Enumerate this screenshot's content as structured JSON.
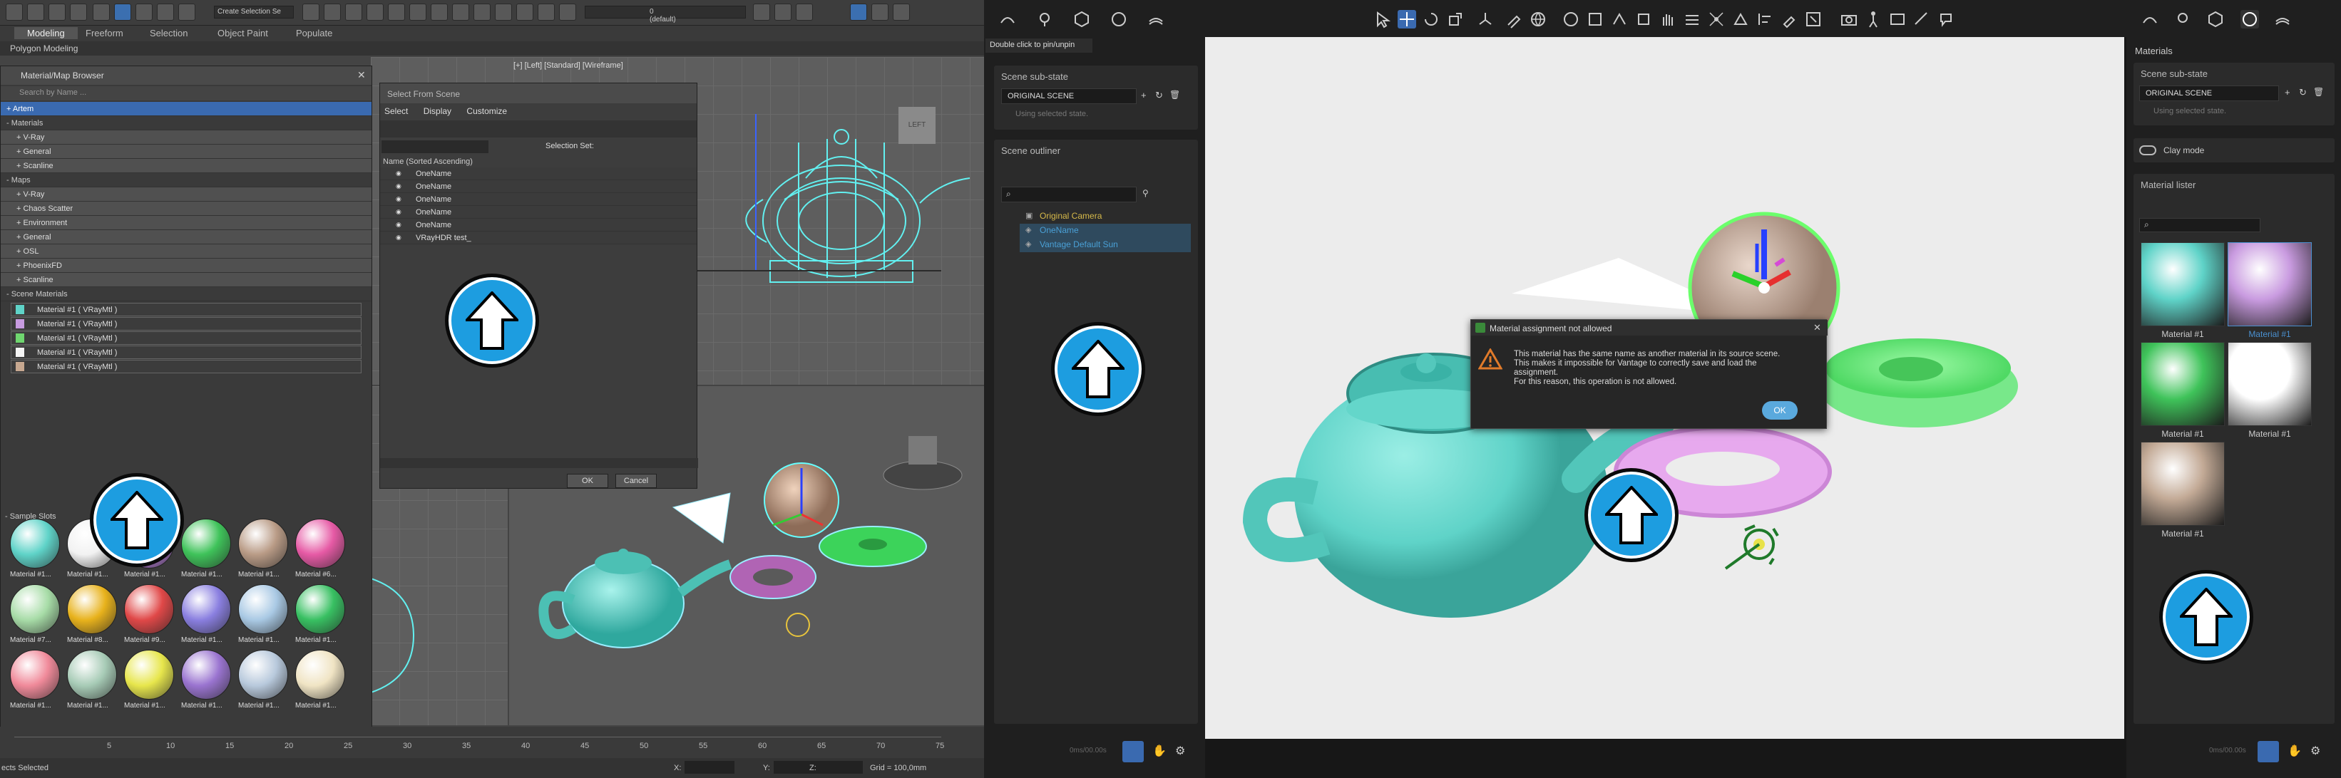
{
  "max": {
    "toolbar": {
      "create_selection_set": "Create Selection Se",
      "layer_value": "0 (default)"
    },
    "ribbon_tabs": [
      "Modeling",
      "Freeform",
      "Selection",
      "Object Paint",
      "Populate"
    ],
    "polygon_modeling": "Polygon Modeling",
    "viewport_label": "[+] [Left] [Standard] [Wireframe]",
    "viewcube_label": "LEFT",
    "material_browser": {
      "title": "Material/Map Browser",
      "search_placeholder": "Search by Name ...",
      "items": [
        {
          "label": "+ Artem",
          "kind": "hi"
        },
        {
          "label": "- Materials",
          "kind": "hdr"
        },
        {
          "label": "+ V-Ray",
          "kind": "sub"
        },
        {
          "label": "+ General",
          "kind": "sub"
        },
        {
          "label": "+ Scanline",
          "kind": "sub"
        },
        {
          "label": "- Maps",
          "kind": "hdr"
        },
        {
          "label": "+ V-Ray",
          "kind": "sub"
        },
        {
          "label": "+ Chaos Scatter",
          "kind": "sub"
        },
        {
          "label": "+ Environment",
          "kind": "sub"
        },
        {
          "label": "+ General",
          "kind": "sub"
        },
        {
          "label": "+ OSL",
          "kind": "sub"
        },
        {
          "label": "+ PhoenixFD",
          "kind": "sub"
        },
        {
          "label": "+ Scanline",
          "kind": "sub"
        },
        {
          "label": "- Scene Materials",
          "kind": "hdr"
        }
      ],
      "scene_materials": [
        {
          "label": "Material #1 ( VRayMtl )",
          "color": "#5fd3c8"
        },
        {
          "label": "Material #1 ( VRayMtl )",
          "color": "#c79be0"
        },
        {
          "label": "Material #1 ( VRayMtl )",
          "color": "#6fd66f"
        },
        {
          "label": "Material #1 ( VRayMtl )",
          "color": "#f4f4f4"
        },
        {
          "label": "Material #1 ( VRayMtl )",
          "color": "#c7a890"
        }
      ],
      "sample_slots_label": "- Sample Slots",
      "slots": [
        {
          "label": "Material #1...",
          "color": "#5fd3c8"
        },
        {
          "label": "Material #1...",
          "color": "#f2f2f2"
        },
        {
          "label": "Material #1...",
          "color": "#b07ad0"
        },
        {
          "label": "Material #1...",
          "color": "#3fc35a"
        },
        {
          "label": "Material #1...",
          "color": "#b99b86"
        },
        {
          "label": "Material #6...",
          "color": "#e65aa5"
        },
        {
          "label": "Material #7...",
          "color": "#a7dca7"
        },
        {
          "label": "Material #8...",
          "color": "#e8b21c"
        },
        {
          "label": "Material #9...",
          "color": "#e04848"
        },
        {
          "label": "Material #1...",
          "color": "#8a7fe0"
        },
        {
          "label": "Material #1...",
          "color": "#a9c9e4"
        },
        {
          "label": "Material #1...",
          "color": "#38c062"
        },
        {
          "label": "Material #1...",
          "color": "#f08a9a"
        },
        {
          "label": "Material #1...",
          "color": "#a7cbb6"
        },
        {
          "label": "Material #1...",
          "color": "#e7e64c"
        },
        {
          "label": "Material #1...",
          "color": "#9a74d0"
        },
        {
          "label": "Material #1...",
          "color": "#b8c9dc"
        },
        {
          "label": "Material #1...",
          "color": "#f0e4c4"
        }
      ]
    },
    "select_from_scene": {
      "title": "Select From Scene",
      "menu": [
        "Select",
        "Display",
        "Customize"
      ],
      "selection_set_label": "Selection Set:",
      "column_header": "Name (Sorted Ascending)",
      "rows": [
        "OneName",
        "OneName",
        "OneName",
        "OneName",
        "OneName",
        "VRayHDR test_"
      ],
      "ok": "OK",
      "cancel": "Cancel"
    },
    "timeline_ticks": [
      "5",
      "10",
      "15",
      "20",
      "25",
      "30",
      "35",
      "40",
      "45",
      "50",
      "55",
      "60",
      "65",
      "70",
      "75"
    ],
    "status": {
      "left_text": "ects Selected",
      "x": "X:",
      "y": "Y:",
      "z": "Z:",
      "grid": "Grid = 100,0mm"
    }
  },
  "vantage_left": {
    "tooltip": "Double click to pin/unpin",
    "scene_substate_title": "Scene sub-state",
    "scene_value": "ORIGINAL SCENE",
    "using_state": "Using selected state.",
    "outliner_title": "Scene outliner",
    "outliner_rows": [
      {
        "label": "Original Camera",
        "color": "#d6b94a"
      },
      {
        "label": "OneName",
        "color": "#4aa0d6"
      },
      {
        "label": "Vantage Default Sun",
        "color": "#4aa0d6"
      }
    ],
    "fps": "0ms/00.00s"
  },
  "vantage_right": {
    "materials_title": "Materials",
    "scene_substate_title": "Scene sub-state",
    "scene_value": "ORIGINAL SCENE",
    "using_state": "Using selected state.",
    "clay_mode": "Clay mode",
    "lister_title": "Material lister",
    "tiles": [
      {
        "label": "Material #1",
        "color": "#5fd3c8"
      },
      {
        "label": "Material #1",
        "color": "#c99be0"
      },
      {
        "label": "Material #1",
        "color": "#3fc35a"
      },
      {
        "label": "Material #1",
        "color": "#ffffff"
      },
      {
        "label": "Material #1",
        "color": "#c3aa96"
      }
    ],
    "fps": "0ms/00.00s"
  },
  "dialog": {
    "title": "Material assignment not allowed",
    "message_lines": [
      "This material has the same name as another material in its source scene.",
      "This makes it impossible for Vantage to correctly save and load the",
      "assignment.",
      "For this reason, this operation is not allowed."
    ],
    "ok": "OK"
  },
  "colors": {
    "accent": "#1d9de0",
    "teapot": "#5fd3c8",
    "torus": "#d99be0",
    "disc": "#5fdc6f"
  }
}
